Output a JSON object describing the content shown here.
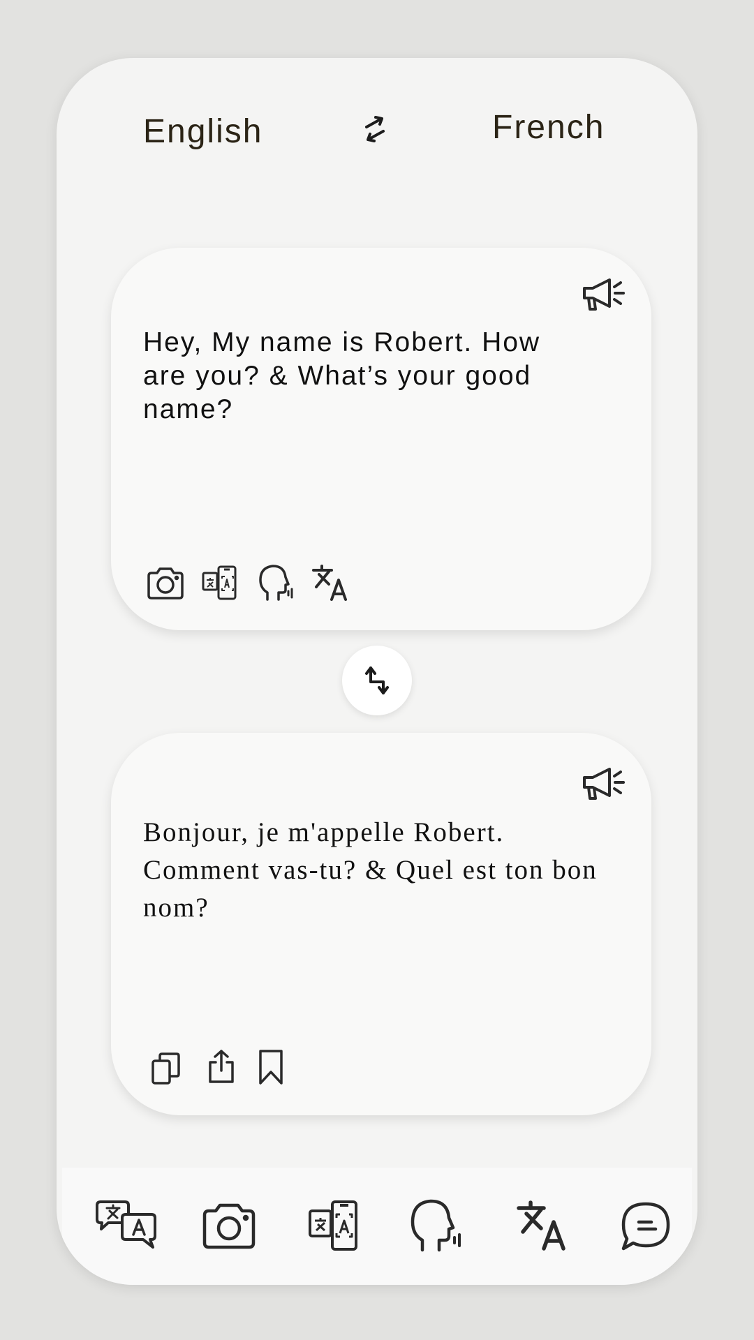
{
  "header": {
    "source_language": "English",
    "target_language": "French",
    "swap_icon": "swap-horizontal-icon"
  },
  "source_card": {
    "text": "Hey, My name is Robert. How are you? & What’s your good name?",
    "speaker_icon": "megaphone-icon",
    "tools": [
      "camera-icon",
      "screen-translate-icon",
      "voice-icon",
      "translate-icon"
    ]
  },
  "middle": {
    "swap_icon": "swap-vertical-icon"
  },
  "target_card": {
    "text": "Bonjour, je m'appelle Robert. Comment vas-tu? & Quel est ton bon nom?",
    "speaker_icon": "megaphone-icon",
    "tools": [
      "copy-icon",
      "share-icon",
      "bookmark-icon"
    ]
  },
  "bottom_nav": {
    "items": [
      "conversation-translate-icon",
      "camera-icon",
      "screen-translate-icon",
      "voice-icon",
      "translate-icon",
      "chat-icon"
    ]
  },
  "colors": {
    "background": "#e2e2e0",
    "phone": "#f4f4f3",
    "card": "#f9f9f8",
    "text": "#111111",
    "language_text": "#2b2416"
  }
}
